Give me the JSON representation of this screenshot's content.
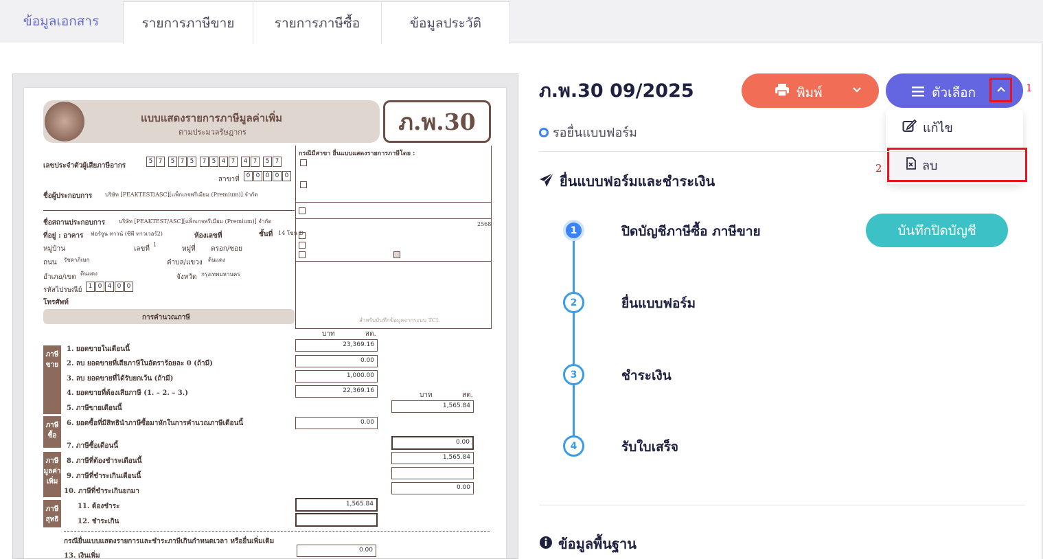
{
  "tabs": {
    "active": "ข้อมูลเอกสาร",
    "items": [
      "รายการภาษีขาย",
      "รายการภาษีซื้อ",
      "ข้อมูลประวัติ"
    ]
  },
  "form": {
    "title": "แบบแสดงรายการภาษีมูลค่าเพิ่ม",
    "subtitle": "ตามประมวลรัษฎากร",
    "code": "ภ.พ.30",
    "tax_id_label": "เลขประจำตัวผู้เสียภาษีอากร",
    "tax_id_digits": [
      "5",
      "7",
      "5",
      "7",
      "5",
      "7",
      "5",
      "4",
      "7",
      "4",
      "7",
      "5",
      "7"
    ],
    "branch_label": "สาขาที่",
    "branch_digits": [
      "0",
      "0",
      "0",
      "0",
      "0"
    ],
    "operator_label": "ชื่อผู้ประกอบการ",
    "operator_name": "บริษัท [PEAKTEST/ASC][แพ็กเกจพรีเมียม (Premium)] จำกัด",
    "place_label": "ชื่อสถานประกอบการ",
    "place_name": "บริษัท [PEAKTEST/ASC][แพ็กเกจพรีเมียม (Premium)] จำกัด",
    "address_label": "ที่อยู่ : อาคาร",
    "building": "ฟอร์จูน ทาวน์ (ซีพี ทาวเวอร์2)",
    "room_label": "ห้องเลขที่",
    "floor_label": "ชั้นที่",
    "floor": "14 โซน D",
    "village_label": "หมู่บ้าน",
    "house_no_label": "เลขที่",
    "house_no": "1",
    "moo_label": "หมู่ที่",
    "soi_label": "ตรอก/ซอย",
    "road_label": "ถนน",
    "road": "รัชดาภิเษก",
    "subdistrict_label": "ตำบล/แขวง",
    "subdistrict": "ดินแดง",
    "district_label": "อำเภอ/เขต",
    "district": "ดินแดง",
    "province_label": "จังหวัด",
    "province": "กรุงเทพมหานคร",
    "postal_label": "รหัสไปรษณีย์",
    "postal_digits": [
      "1",
      "0",
      "4",
      "0",
      "0"
    ],
    "phone_label": "โทรศัพท์",
    "calc_header": "การคำนวณภาษี",
    "branch_section_title": "กรณีมีสาขา ยื่นแบบแสดงรายการภาษีโดย :",
    "tcl_note": "สำหรับบันทึกข้อมูลจากระบบ TCL",
    "year": "2568",
    "baht_label": "บาท",
    "satang_label": "สต.",
    "side_sales": "ภาษีขาย",
    "side_purchase": "ภาษีซื้อ",
    "side_vat": "ภาษีมูลค่าเพิ่ม",
    "side_net": "ภาษีสุทธิ",
    "lines": [
      {
        "label": "1. ยอดขายในเดือนนี้",
        "value": "23,369.16"
      },
      {
        "label": "2. ลบ ยอดขายที่เสียภาษีในอัตราร้อยละ 0 (ถ้ามี)",
        "value": "0.00"
      },
      {
        "label": "3. ลบ ยอดขายที่ได้รับยกเว้น (ถ้ามี)",
        "value": "1,000.00"
      },
      {
        "label": "4. ยอดขายที่ต้องเสียภาษี (1. – 2. – 3.)",
        "value": "22,369.16"
      },
      {
        "label": "5. ภาษีขายเดือนนี้",
        "value": "1,565.84"
      },
      {
        "label": "6. ยอดซื้อที่มีสิทธินำภาษีซื้อมาหักในการคำนวณภาษีเดือนนี้",
        "value": "0.00"
      },
      {
        "label": "7. ภาษีซื้อเดือนนี้",
        "value": "0.00"
      },
      {
        "label": "8. ภาษีที่ต้องชำระเดือนนี้",
        "value": "1,565.84"
      },
      {
        "label": "9. ภาษีที่ชำระเกินเดือนนี้",
        "value": ""
      },
      {
        "label": "10. ภาษีที่ชำระเกินยกมา",
        "value": "0.00"
      },
      {
        "label": "11. ต้องชำระ",
        "value": "1,565.84"
      },
      {
        "label": "12. ชำระเกิน",
        "value": ""
      },
      {
        "label": "13. เงินเพิ่ม",
        "value": "0.00"
      }
    ],
    "late_note": "กรณียื่นแบบแสดงรายการและชำระภาษีเกินกำหนดเวลา หรือยื่นเพิ่มเติม"
  },
  "document": {
    "title": "ภ.พ.30 09/2025",
    "status": "รอยื่นแบบฟอร์ม"
  },
  "buttons": {
    "print": "พิมพ์",
    "options": "ตัวเลือก",
    "close_books": "บันทึกปิดบัญชี"
  },
  "menu": {
    "edit": "แก้ไข",
    "delete": "ลบ"
  },
  "annotations": {
    "one": "1",
    "two": "2"
  },
  "sections": {
    "submit_pay": "ยื่นแบบฟอร์มและชำระเงิน",
    "basic_info": "ข้อมูลพื้นฐาน"
  },
  "steps": [
    {
      "num": "1",
      "label": "ปิดบัญชีภาษีซื้อ ภาษีขาย"
    },
    {
      "num": "2",
      "label": "ยื่นแบบฟอร์ม"
    },
    {
      "num": "3",
      "label": "ชำระเงิน"
    },
    {
      "num": "4",
      "label": "รับใบเสร็จ"
    }
  ],
  "colors": {
    "primary": "#6366e0",
    "print": "#f26d55",
    "teal": "#3cc2c6",
    "step": "#3b9ce6",
    "highlight": "#e8141f"
  }
}
